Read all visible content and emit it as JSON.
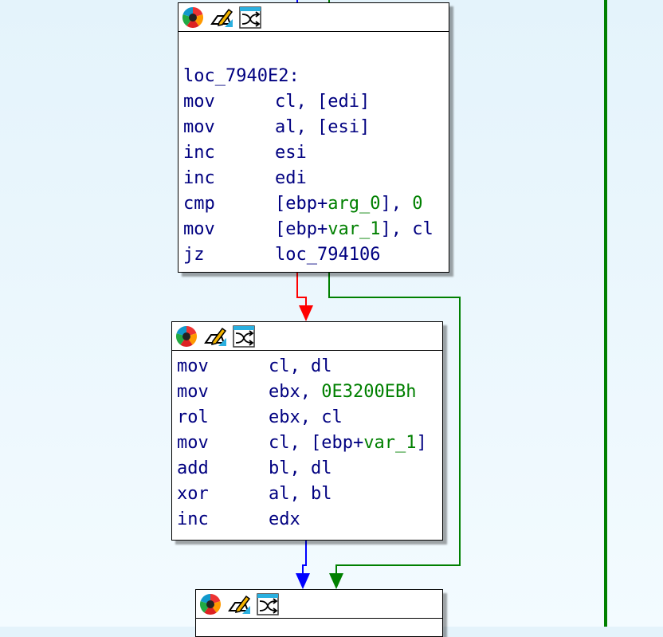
{
  "colors": {
    "text": "#000080",
    "symbol": "#008000",
    "edge_false": "#ff0000",
    "edge_true": "#008000",
    "edge_uncond": "#0000ff"
  },
  "header_icons": [
    "color-wheel-icon",
    "pencil-edit-icon",
    "shuffle-graph-icon"
  ],
  "blocks": [
    {
      "id": "block-1",
      "label": "loc_7940E2:",
      "lines": [
        {
          "mnemonic": "mov",
          "parts": [
            {
              "t": "cl, [edi]"
            }
          ]
        },
        {
          "mnemonic": "mov",
          "parts": [
            {
              "t": "al, [esi]"
            }
          ]
        },
        {
          "mnemonic": "inc",
          "parts": [
            {
              "t": "esi"
            }
          ]
        },
        {
          "mnemonic": "inc",
          "parts": [
            {
              "t": "edi"
            }
          ]
        },
        {
          "mnemonic": "cmp",
          "parts": [
            {
              "t": "[ebp+"
            },
            {
              "t": "arg_0",
              "g": true
            },
            {
              "t": "], "
            },
            {
              "t": "0",
              "g": true
            }
          ]
        },
        {
          "mnemonic": "mov",
          "parts": [
            {
              "t": "[ebp+"
            },
            {
              "t": "var_1",
              "g": true
            },
            {
              "t": "], cl"
            }
          ]
        },
        {
          "mnemonic": "jz",
          "parts": [
            {
              "t": "loc_794106"
            }
          ]
        }
      ]
    },
    {
      "id": "block-2",
      "label": "",
      "lines": [
        {
          "mnemonic": "mov",
          "parts": [
            {
              "t": "cl, dl"
            }
          ]
        },
        {
          "mnemonic": "mov",
          "parts": [
            {
              "t": "ebx, "
            },
            {
              "t": "0E3200EBh",
              "g": true
            }
          ]
        },
        {
          "mnemonic": "rol",
          "parts": [
            {
              "t": "ebx, cl"
            }
          ]
        },
        {
          "mnemonic": "mov",
          "parts": [
            {
              "t": "cl, [ebp+"
            },
            {
              "t": "var_1",
              "g": true
            },
            {
              "t": "]"
            }
          ]
        },
        {
          "mnemonic": "add",
          "parts": [
            {
              "t": "bl, dl"
            }
          ]
        },
        {
          "mnemonic": "xor",
          "parts": [
            {
              "t": "al, bl"
            }
          ]
        },
        {
          "mnemonic": "inc",
          "parts": [
            {
              "t": "edx"
            }
          ]
        }
      ]
    },
    {
      "id": "block-3",
      "label": "",
      "lines": []
    }
  ]
}
